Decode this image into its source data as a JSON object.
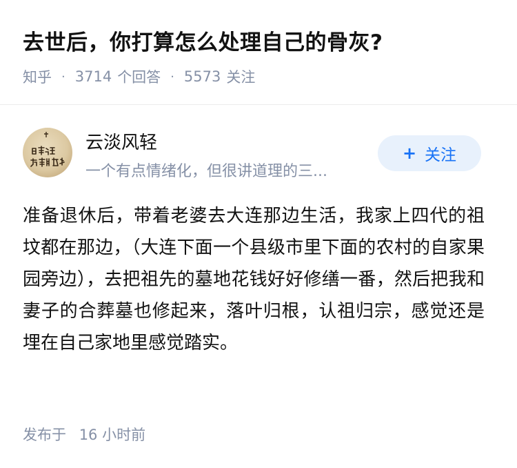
{
  "question": {
    "title": "去世后，你打算怎么处理自己的骨灰?",
    "source": "知乎",
    "answers_count": "3714",
    "answers_label": "个回答",
    "follows_count": "5573",
    "follows_label": "关注",
    "separator": "·"
  },
  "author": {
    "name": "云淡风轻",
    "bio": "一个有点情绪化，但很讲道理的三...",
    "avatar_text": "日事通 万事皆成",
    "follow_icon": "plus-icon",
    "follow_label": "关注"
  },
  "answer": {
    "content": "准备退休后，带着老婆去大连那边生活，我家上四代的祖坟都在那边，（大连下面一个县级市里下面的农村的自家果园旁边），去把祖先的墓地花钱好好修缮一番，然后把我和妻子的合葬墓也修起来，落叶归根，认祖归宗，感觉还是埋在自己家地里感觉踏实。"
  },
  "footer": {
    "published_label": "发布于",
    "time": "16 小时前"
  },
  "colors": {
    "text_primary": "#121212",
    "text_secondary": "#8590a6",
    "brand_blue": "#1772f6",
    "follow_bg": "#e8f1fc"
  }
}
